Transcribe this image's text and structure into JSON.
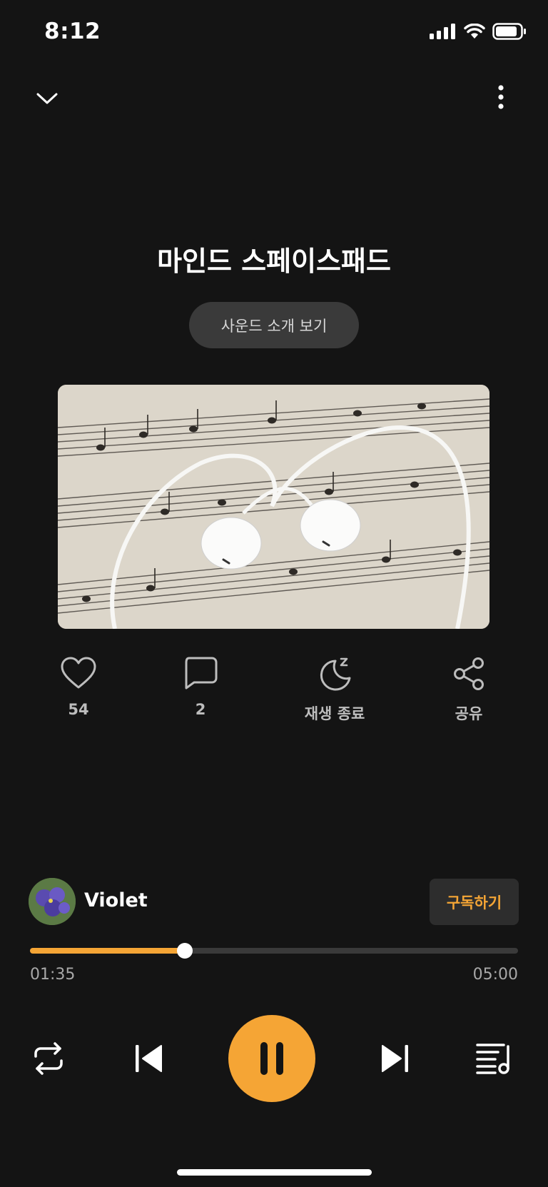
{
  "status_bar": {
    "time": "8:12"
  },
  "track": {
    "title": "마인드 스페이스패드",
    "intro_button": "사운드 소개 보기"
  },
  "actions": {
    "like_count": "54",
    "comment_count": "2",
    "sleep_timer_label": "재생 종료",
    "share_label": "공유"
  },
  "channel": {
    "name": "Violet",
    "subscribe_label": "구독하기"
  },
  "player": {
    "elapsed": "01:35",
    "duration": "05:00",
    "progress": 0.317
  },
  "colors": {
    "accent": "#f5a535",
    "background": "#141414"
  },
  "icons": [
    "chevron-down-icon",
    "more-vertical-icon",
    "heart-icon",
    "comment-icon",
    "moon-icon",
    "share-icon",
    "repeat-icon",
    "skip-previous-icon",
    "pause-icon",
    "skip-next-icon",
    "playlist-icon"
  ]
}
